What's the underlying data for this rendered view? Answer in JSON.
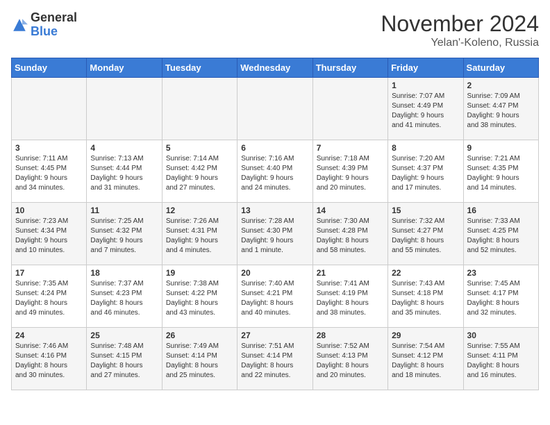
{
  "header": {
    "logo_general": "General",
    "logo_blue": "Blue",
    "month_title": "November 2024",
    "location": "Yelan'-Koleno, Russia"
  },
  "days_of_week": [
    "Sunday",
    "Monday",
    "Tuesday",
    "Wednesday",
    "Thursday",
    "Friday",
    "Saturday"
  ],
  "weeks": [
    [
      {
        "day": "",
        "info": ""
      },
      {
        "day": "",
        "info": ""
      },
      {
        "day": "",
        "info": ""
      },
      {
        "day": "",
        "info": ""
      },
      {
        "day": "",
        "info": ""
      },
      {
        "day": "1",
        "info": "Sunrise: 7:07 AM\nSunset: 4:49 PM\nDaylight: 9 hours\nand 41 minutes."
      },
      {
        "day": "2",
        "info": "Sunrise: 7:09 AM\nSunset: 4:47 PM\nDaylight: 9 hours\nand 38 minutes."
      }
    ],
    [
      {
        "day": "3",
        "info": "Sunrise: 7:11 AM\nSunset: 4:45 PM\nDaylight: 9 hours\nand 34 minutes."
      },
      {
        "day": "4",
        "info": "Sunrise: 7:13 AM\nSunset: 4:44 PM\nDaylight: 9 hours\nand 31 minutes."
      },
      {
        "day": "5",
        "info": "Sunrise: 7:14 AM\nSunset: 4:42 PM\nDaylight: 9 hours\nand 27 minutes."
      },
      {
        "day": "6",
        "info": "Sunrise: 7:16 AM\nSunset: 4:40 PM\nDaylight: 9 hours\nand 24 minutes."
      },
      {
        "day": "7",
        "info": "Sunrise: 7:18 AM\nSunset: 4:39 PM\nDaylight: 9 hours\nand 20 minutes."
      },
      {
        "day": "8",
        "info": "Sunrise: 7:20 AM\nSunset: 4:37 PM\nDaylight: 9 hours\nand 17 minutes."
      },
      {
        "day": "9",
        "info": "Sunrise: 7:21 AM\nSunset: 4:35 PM\nDaylight: 9 hours\nand 14 minutes."
      }
    ],
    [
      {
        "day": "10",
        "info": "Sunrise: 7:23 AM\nSunset: 4:34 PM\nDaylight: 9 hours\nand 10 minutes."
      },
      {
        "day": "11",
        "info": "Sunrise: 7:25 AM\nSunset: 4:32 PM\nDaylight: 9 hours\nand 7 minutes."
      },
      {
        "day": "12",
        "info": "Sunrise: 7:26 AM\nSunset: 4:31 PM\nDaylight: 9 hours\nand 4 minutes."
      },
      {
        "day": "13",
        "info": "Sunrise: 7:28 AM\nSunset: 4:30 PM\nDaylight: 9 hours\nand 1 minute."
      },
      {
        "day": "14",
        "info": "Sunrise: 7:30 AM\nSunset: 4:28 PM\nDaylight: 8 hours\nand 58 minutes."
      },
      {
        "day": "15",
        "info": "Sunrise: 7:32 AM\nSunset: 4:27 PM\nDaylight: 8 hours\nand 55 minutes."
      },
      {
        "day": "16",
        "info": "Sunrise: 7:33 AM\nSunset: 4:25 PM\nDaylight: 8 hours\nand 52 minutes."
      }
    ],
    [
      {
        "day": "17",
        "info": "Sunrise: 7:35 AM\nSunset: 4:24 PM\nDaylight: 8 hours\nand 49 minutes."
      },
      {
        "day": "18",
        "info": "Sunrise: 7:37 AM\nSunset: 4:23 PM\nDaylight: 8 hours\nand 46 minutes."
      },
      {
        "day": "19",
        "info": "Sunrise: 7:38 AM\nSunset: 4:22 PM\nDaylight: 8 hours\nand 43 minutes."
      },
      {
        "day": "20",
        "info": "Sunrise: 7:40 AM\nSunset: 4:21 PM\nDaylight: 8 hours\nand 40 minutes."
      },
      {
        "day": "21",
        "info": "Sunrise: 7:41 AM\nSunset: 4:19 PM\nDaylight: 8 hours\nand 38 minutes."
      },
      {
        "day": "22",
        "info": "Sunrise: 7:43 AM\nSunset: 4:18 PM\nDaylight: 8 hours\nand 35 minutes."
      },
      {
        "day": "23",
        "info": "Sunrise: 7:45 AM\nSunset: 4:17 PM\nDaylight: 8 hours\nand 32 minutes."
      }
    ],
    [
      {
        "day": "24",
        "info": "Sunrise: 7:46 AM\nSunset: 4:16 PM\nDaylight: 8 hours\nand 30 minutes."
      },
      {
        "day": "25",
        "info": "Sunrise: 7:48 AM\nSunset: 4:15 PM\nDaylight: 8 hours\nand 27 minutes."
      },
      {
        "day": "26",
        "info": "Sunrise: 7:49 AM\nSunset: 4:14 PM\nDaylight: 8 hours\nand 25 minutes."
      },
      {
        "day": "27",
        "info": "Sunrise: 7:51 AM\nSunset: 4:14 PM\nDaylight: 8 hours\nand 22 minutes."
      },
      {
        "day": "28",
        "info": "Sunrise: 7:52 AM\nSunset: 4:13 PM\nDaylight: 8 hours\nand 20 minutes."
      },
      {
        "day": "29",
        "info": "Sunrise: 7:54 AM\nSunset: 4:12 PM\nDaylight: 8 hours\nand 18 minutes."
      },
      {
        "day": "30",
        "info": "Sunrise: 7:55 AM\nSunset: 4:11 PM\nDaylight: 8 hours\nand 16 minutes."
      }
    ]
  ]
}
